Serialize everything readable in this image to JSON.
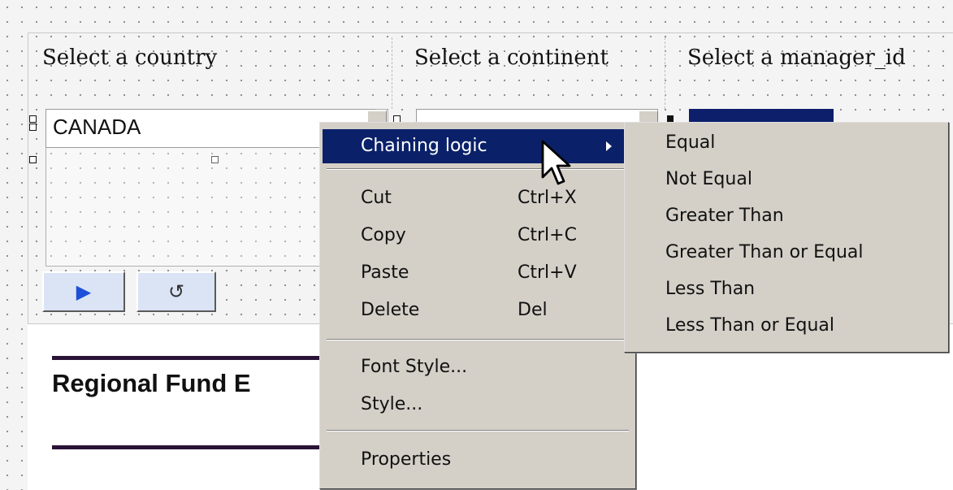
{
  "prompts": {
    "country": "Select a country",
    "continent": "Select a continent",
    "manager": "Select a manager_id"
  },
  "country_list": {
    "selected_value": "CANADA"
  },
  "buttons": {
    "run_glyph": "▶",
    "reset_glyph": "↺"
  },
  "report": {
    "title": "Regional Fund E"
  },
  "context_menu": {
    "chaining_logic": "Chaining logic",
    "cut": "Cut",
    "cut_shortcut": "Ctrl+X",
    "copy": "Copy",
    "copy_shortcut": "Ctrl+C",
    "paste": "Paste",
    "paste_shortcut": "Ctrl+V",
    "delete": "Delete",
    "delete_shortcut": "Del",
    "font_style": "Font Style...",
    "style": "Style...",
    "properties": "Properties"
  },
  "submenu": {
    "items": [
      "Equal",
      "Not Equal",
      "Greater Than",
      "Greater Than or Equal",
      "Less Than",
      "Less Than or Equal"
    ]
  },
  "colors": {
    "menu_highlight": "#0a2169",
    "menu_bg": "#d4d0c8",
    "run_button_bg": "#dbe4f4"
  }
}
